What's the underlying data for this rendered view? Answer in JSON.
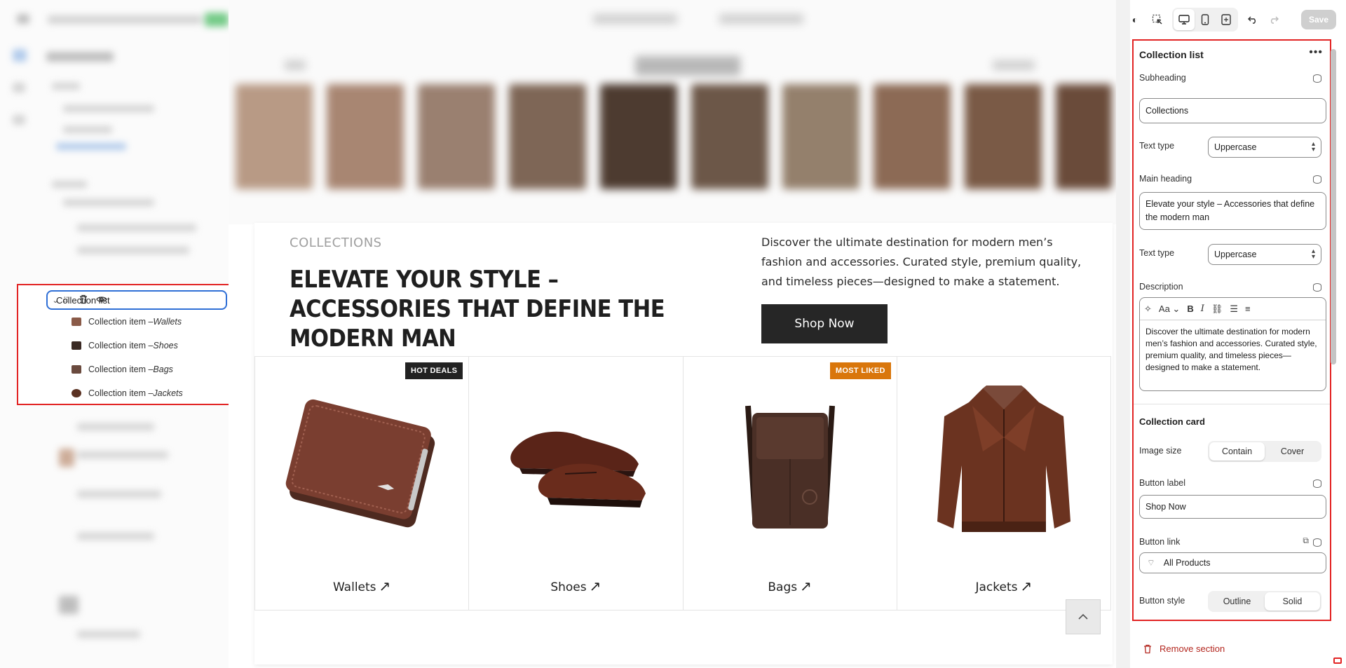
{
  "layers": {
    "section": {
      "label": "Collection list"
    },
    "items": [
      {
        "prefix": "Collection item – ",
        "name": "Wallets",
        "thumb": "#8a5a48"
      },
      {
        "prefix": "Collection item – ",
        "name": "Shoes",
        "thumb": "#3a2a24"
      },
      {
        "prefix": "Collection item – ",
        "name": "Bags",
        "thumb": "#6a4a3e"
      },
      {
        "prefix": "Collection item – ",
        "name": "Jackets",
        "thumb": "#5a3122"
      }
    ]
  },
  "preview": {
    "subheading": "COLLECTIONS",
    "heading": "ELEVATE YOUR STYLE – ACCESSORIES THAT DEFINE THE MODERN MAN",
    "description": "Discover the ultimate destination for modern men’s fashion and accessories. Curated style, premium quality, and timeless pieces—designed to make a statement.",
    "button": "Shop Now",
    "cards": [
      {
        "title": "Wallets",
        "badge": "HOT DEALS",
        "badge_color": "#222222"
      },
      {
        "title": "Shoes",
        "badge": "",
        "badge_color": ""
      },
      {
        "title": "Bags",
        "badge": "MOST LIKED",
        "badge_color": "#d9760b"
      },
      {
        "title": "Jackets",
        "badge": "",
        "badge_color": ""
      }
    ],
    "arrow_glyph": "↗"
  },
  "toolbar": {
    "save": "Save"
  },
  "settings": {
    "title": "Collection list",
    "subheading_label": "Subheading",
    "subheading_value": "Collections",
    "text_type_label": "Text type",
    "text_type_value": "Uppercase",
    "main_heading_label": "Main heading",
    "main_heading_value": "Elevate your style – Accessories that define the modern man",
    "text_type2_label": "Text type",
    "text_type2_value": "Uppercase",
    "description_label": "Description",
    "description_value": "Discover the ultimate destination for modern men’s fashion and accessories. Curated style, premium quality, and timeless pieces—designed to make a statement.",
    "card_section": "Collection card",
    "image_size_label": "Image size",
    "image_size_options": [
      "Contain",
      "Cover"
    ],
    "button_label_label": "Button label",
    "button_label_value": "Shop Now",
    "button_link_label": "Button link",
    "button_link_value": "All Products",
    "button_style_label": "Button style",
    "button_style_options": [
      "Outline",
      "Solid"
    ],
    "remove": "Remove section"
  }
}
